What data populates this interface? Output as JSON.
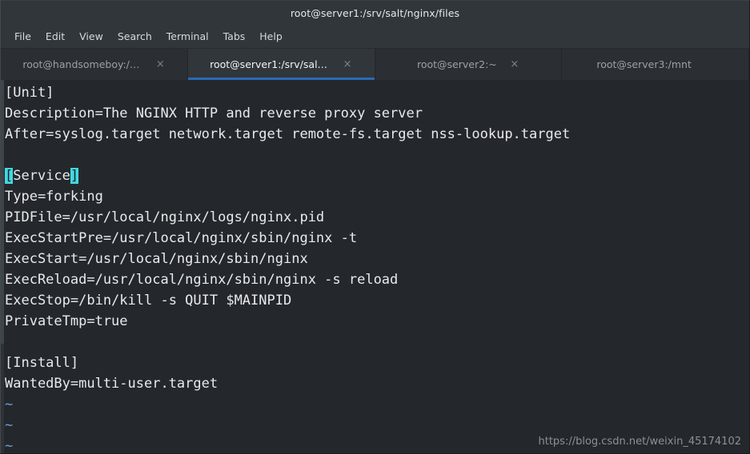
{
  "window": {
    "title": "root@server1:/srv/salt/nginx/files"
  },
  "menubar": {
    "items": [
      {
        "label": "File"
      },
      {
        "label": "Edit"
      },
      {
        "label": "View"
      },
      {
        "label": "Search"
      },
      {
        "label": "Terminal"
      },
      {
        "label": "Tabs"
      },
      {
        "label": "Help"
      }
    ]
  },
  "tabs": {
    "close_glyph": "×",
    "items": [
      {
        "label": "root@handsomeboy:/mn…",
        "active": false,
        "has_close": true
      },
      {
        "label": "root@server1:/srv/salt/n…",
        "active": true,
        "has_close": true
      },
      {
        "label": "root@server2:~",
        "active": false,
        "has_close": true
      },
      {
        "label": "root@server3:/mnt",
        "active": false,
        "has_close": false
      }
    ]
  },
  "terminal": {
    "editor": "vim",
    "file_type": "systemd-unit",
    "colors": {
      "background": "#24282c",
      "foreground": "#e8eaec",
      "tilde": "#6a9fd8",
      "match_bracket_bg": "#41d8e0",
      "accent_tab_underline": "#2a6bb5"
    },
    "lines": [
      {
        "segments": [
          {
            "text": "[Unit]"
          }
        ]
      },
      {
        "segments": [
          {
            "text": "Description=The NGINX HTTP and reverse proxy server"
          }
        ]
      },
      {
        "segments": [
          {
            "text": "After=syslog.target network.target remote-fs.target nss-lookup.target"
          }
        ]
      },
      {
        "segments": [
          {
            "text": ""
          }
        ]
      },
      {
        "segments": [
          {
            "text": "[",
            "style": "match-bracket"
          },
          {
            "text": "Service"
          },
          {
            "text": "]",
            "style": "match-bracket"
          }
        ]
      },
      {
        "segments": [
          {
            "text": "Type=forking"
          }
        ]
      },
      {
        "segments": [
          {
            "text": "PIDFile=/usr/local/nginx/logs/nginx.pid"
          }
        ]
      },
      {
        "segments": [
          {
            "text": "ExecStartPre=/usr/local/nginx/sbin/nginx -t"
          }
        ]
      },
      {
        "segments": [
          {
            "text": "ExecStart=/usr/local/nginx/sbin/nginx"
          }
        ]
      },
      {
        "segments": [
          {
            "text": "ExecReload=/usr/local/nginx/sbin/nginx -s reload"
          }
        ]
      },
      {
        "segments": [
          {
            "text": "ExecStop=/bin/kill -s QUIT $MAINPID"
          }
        ]
      },
      {
        "segments": [
          {
            "text": "PrivateTmp=true"
          }
        ]
      },
      {
        "segments": [
          {
            "text": ""
          }
        ]
      },
      {
        "segments": [
          {
            "text": "[Install]"
          }
        ]
      },
      {
        "segments": [
          {
            "text": "WantedBy=multi-user.target"
          }
        ]
      },
      {
        "segments": [
          {
            "text": "~",
            "style": "tilde"
          }
        ]
      },
      {
        "segments": [
          {
            "text": "~",
            "style": "tilde"
          }
        ]
      },
      {
        "segments": [
          {
            "text": "~",
            "style": "tilde"
          }
        ]
      }
    ]
  },
  "watermark": {
    "text": "https://blog.csdn.net/weixin_45174102"
  }
}
